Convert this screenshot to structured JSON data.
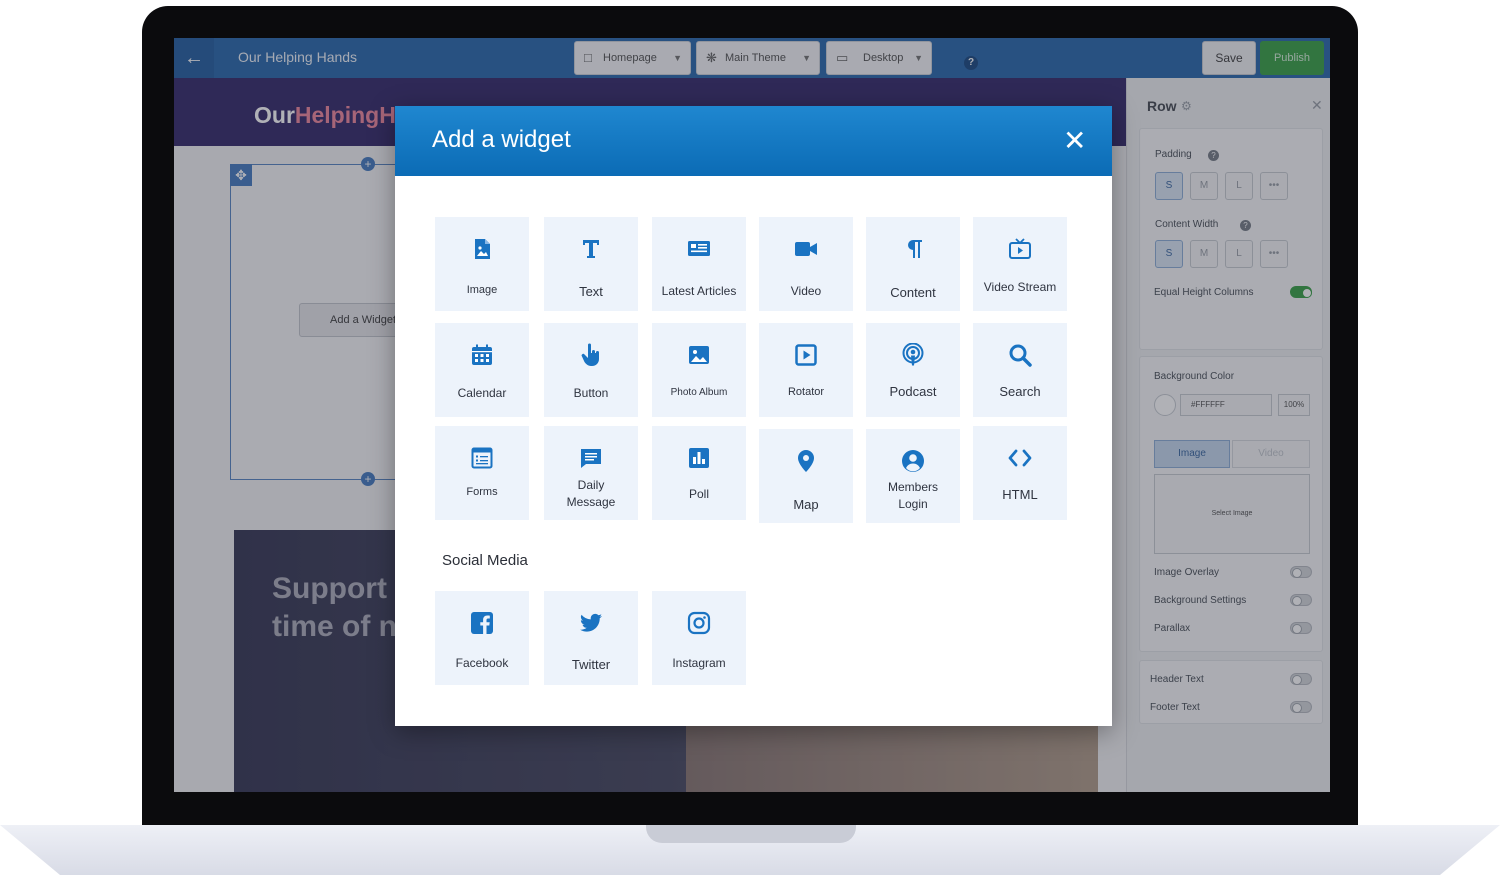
{
  "editor": {
    "site_title": "Our Helping Hands",
    "page_dropdown": "Homepage",
    "theme_dropdown": "Main Theme",
    "device_dropdown": "Desktop",
    "help_label": "?",
    "save_label": "Save",
    "publish_label": "Publish"
  },
  "preview": {
    "logo_part1": "Our",
    "logo_part2": "Helping",
    "logo_part3": "H",
    "add_widget_label": "Add a Widget",
    "hero_line1": "Support",
    "hero_line2": "time of n"
  },
  "panel": {
    "title": "Row",
    "padding_label": "Padding",
    "padding_options": [
      "S",
      "M",
      "L",
      "•••"
    ],
    "content_width_label": "Content Width",
    "content_width_options": [
      "S",
      "M",
      "L",
      "•••"
    ],
    "equal_height_label": "Equal Height Columns",
    "equal_height_on": true,
    "background_color_label": "Background Color",
    "background_color_hex": "#FFFFFF",
    "background_opacity": "100%",
    "bg_tab_image": "Image",
    "bg_tab_video": "Video",
    "select_image_label": "Select Image",
    "image_overlay_label": "Image Overlay",
    "background_settings_label": "Background Settings",
    "parallax_label": "Parallax",
    "header_text_label": "Header Text",
    "footer_text_label": "Footer Text"
  },
  "modal": {
    "title": "Add a widget",
    "close_symbol": "✕",
    "social_section_label": "Social Media",
    "widgets": [
      {
        "label": "Image",
        "icon": "image-icon"
      },
      {
        "label": "Text",
        "icon": "text-icon"
      },
      {
        "label": "Latest Articles",
        "icon": "articles-icon"
      },
      {
        "label": "Video",
        "icon": "video-camera-icon"
      },
      {
        "label": "Content",
        "icon": "paragraph-icon"
      },
      {
        "label": "Video Stream",
        "icon": "tv-icon"
      },
      {
        "label": "Calendar",
        "icon": "calendar-icon"
      },
      {
        "label": "Button",
        "icon": "pointer-hand-icon"
      },
      {
        "label": "Photo Album",
        "icon": "photo-icon"
      },
      {
        "label": "Rotator",
        "icon": "play-square-icon"
      },
      {
        "label": "Podcast",
        "icon": "podcast-icon"
      },
      {
        "label": "Search",
        "icon": "search-icon"
      },
      {
        "label": "Forms",
        "icon": "form-icon"
      },
      {
        "label": "Daily Message",
        "icon": "message-icon"
      },
      {
        "label": "Poll",
        "icon": "poll-icon"
      },
      {
        "label": "Map",
        "icon": "map-pin-icon"
      },
      {
        "label": "Members Login",
        "icon": "user-icon"
      },
      {
        "label": "HTML",
        "icon": "code-icon"
      }
    ],
    "social": [
      {
        "label": "Facebook",
        "icon": "facebook-icon"
      },
      {
        "label": "Twitter",
        "icon": "twitter-icon"
      },
      {
        "label": "Instagram",
        "icon": "instagram-icon"
      }
    ]
  },
  "colors": {
    "accent_blue": "#0b6bb5",
    "icon_blue": "#1a73c2",
    "tile_bg": "#edf3fb",
    "publish_green": "#3ea34b"
  }
}
